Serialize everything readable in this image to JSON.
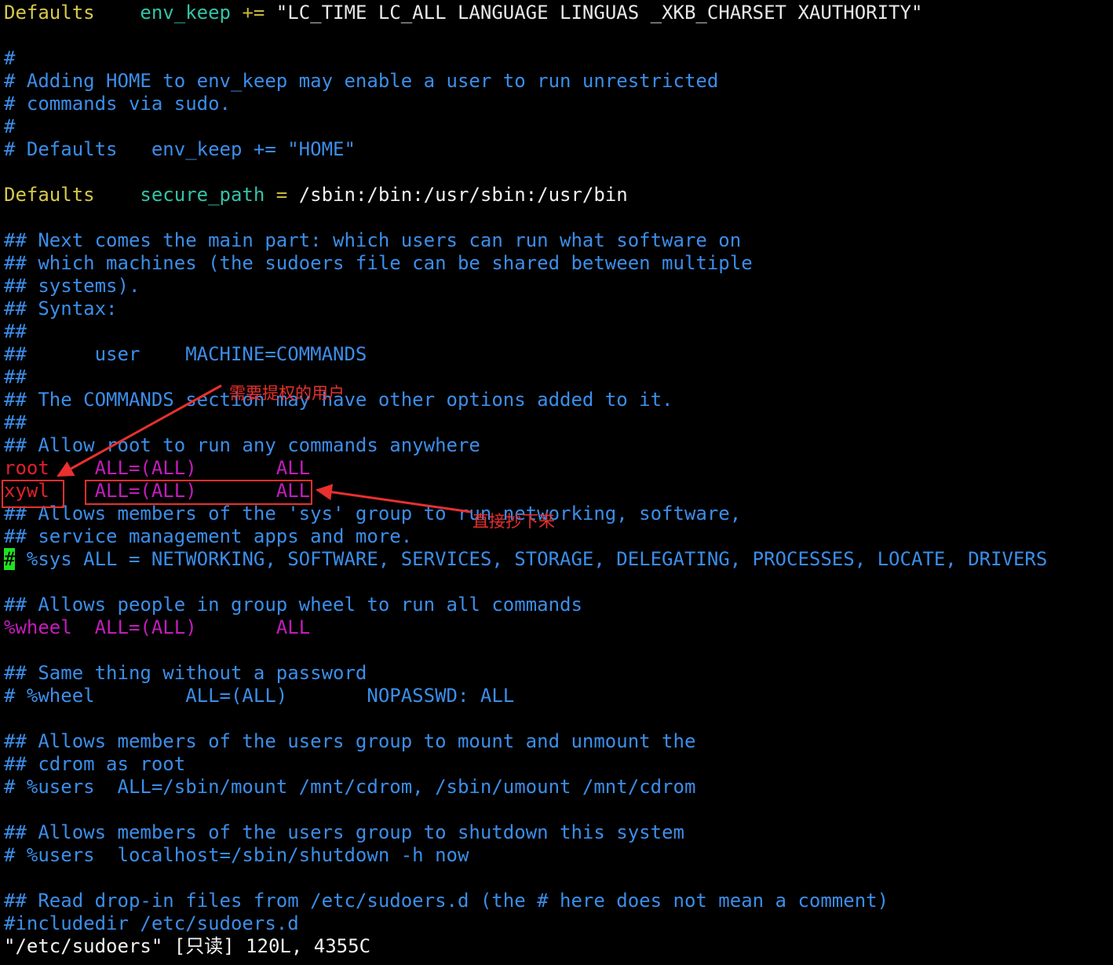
{
  "editor": {
    "lines": [
      [
        {
          "t": "Defaults",
          "c": "key"
        },
        {
          "t": "    ",
          "c": "str"
        },
        {
          "t": "env_keep",
          "c": "var"
        },
        {
          "t": " ",
          "c": "str"
        },
        {
          "t": "+=",
          "c": "op"
        },
        {
          "t": " \"LC_TIME LC_ALL LANGUAGE LINGUAS _XKB_CHARSET XAUTHORITY\"",
          "c": "str"
        }
      ],
      [],
      [
        {
          "t": "#",
          "c": "comment"
        }
      ],
      [
        {
          "t": "# Adding HOME to env_keep may enable a user to run unrestricted",
          "c": "comment"
        }
      ],
      [
        {
          "t": "# commands via sudo.",
          "c": "comment"
        }
      ],
      [
        {
          "t": "#",
          "c": "comment"
        }
      ],
      [
        {
          "t": "# Defaults   env_keep += \"HOME\"",
          "c": "comment"
        }
      ],
      [],
      [
        {
          "t": "Defaults",
          "c": "key"
        },
        {
          "t": "    ",
          "c": "str"
        },
        {
          "t": "secure_path",
          "c": "var"
        },
        {
          "t": " ",
          "c": "str"
        },
        {
          "t": "=",
          "c": "op"
        },
        {
          "t": " /sbin:/bin:/usr/sbin:/usr/bin",
          "c": "path"
        }
      ],
      [],
      [
        {
          "t": "## Next comes the main part: which users can run what software on",
          "c": "comment"
        }
      ],
      [
        {
          "t": "## which machines (the sudoers file can be shared between multiple",
          "c": "comment"
        }
      ],
      [
        {
          "t": "## systems).",
          "c": "comment"
        }
      ],
      [
        {
          "t": "## Syntax:",
          "c": "comment"
        }
      ],
      [
        {
          "t": "##",
          "c": "comment"
        }
      ],
      [
        {
          "t": "##      user    MACHINE=COMMANDS",
          "c": "comment"
        }
      ],
      [
        {
          "t": "##",
          "c": "comment"
        }
      ],
      [
        {
          "t": "## The COMMANDS section may have other options added to it.",
          "c": "comment"
        }
      ],
      [
        {
          "t": "##",
          "c": "comment"
        }
      ],
      [
        {
          "t": "## Allow root to run any commands anywhere",
          "c": "comment"
        }
      ],
      [
        {
          "t": "root",
          "c": "user"
        },
        {
          "t": "    ",
          "c": "str"
        },
        {
          "t": "ALL=(ALL)       ALL",
          "c": "spec"
        }
      ],
      [
        {
          "t": "xywl",
          "c": "user"
        },
        {
          "t": "    ",
          "c": "str"
        },
        {
          "t": "ALL=(ALL)       ALL",
          "c": "spec"
        }
      ],
      [
        {
          "t": "## Allows members of the 'sys' group to run networking, software,",
          "c": "comment"
        }
      ],
      [
        {
          "t": "## service management apps and more.",
          "c": "comment"
        }
      ],
      [
        {
          "t": "#",
          "c": "cursor"
        },
        {
          "t": " %sys ALL = NETWORKING, SOFTWARE, SERVICES, STORAGE, DELEGATING, PROCESSES, LOCATE, DRIVERS",
          "c": "comment"
        }
      ],
      [],
      [
        {
          "t": "## Allows people in group wheel to run all commands",
          "c": "comment"
        }
      ],
      [
        {
          "t": "%wheel",
          "c": "wheel"
        },
        {
          "t": "  ",
          "c": "str"
        },
        {
          "t": "ALL=(ALL)       ALL",
          "c": "spec"
        }
      ],
      [],
      [
        {
          "t": "## Same thing without a password",
          "c": "comment"
        }
      ],
      [
        {
          "t": "# %wheel        ALL=(ALL)       NOPASSWD: ALL",
          "c": "comment"
        }
      ],
      [],
      [
        {
          "t": "## Allows members of the users group to mount and unmount the",
          "c": "comment"
        }
      ],
      [
        {
          "t": "## cdrom as root",
          "c": "comment"
        }
      ],
      [
        {
          "t": "# %users  ALL=/sbin/mount /mnt/cdrom, /sbin/umount /mnt/cdrom",
          "c": "comment"
        }
      ],
      [],
      [
        {
          "t": "## Allows members of the users group to shutdown this system",
          "c": "comment"
        }
      ],
      [
        {
          "t": "# %users  localhost=/sbin/shutdown -h now",
          "c": "comment"
        }
      ],
      [],
      [
        {
          "t": "## Read drop-in files from /etc/sudoers.d (the # here does not mean a comment)",
          "c": "comment"
        }
      ],
      [
        {
          "t": "#includedir /etc/sudoers.d",
          "c": "comment"
        }
      ]
    ],
    "status_line": "\"/etc/sudoers\" [只读] 120L, 4355C"
  },
  "annotations": {
    "user_label": "需要提权的用户",
    "copy_label": "直接抄下来",
    "color": "#e8302f"
  }
}
